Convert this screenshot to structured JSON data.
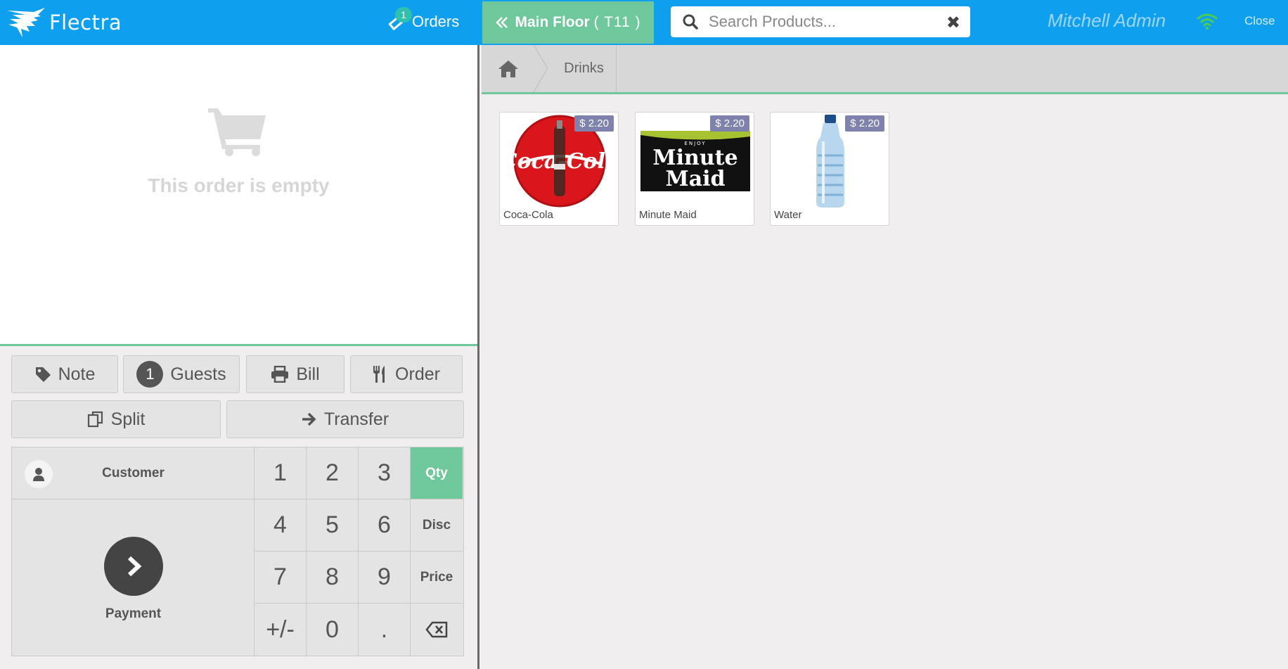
{
  "header": {
    "logo_text": "Flectra",
    "orders_label": "Orders",
    "orders_count": "1",
    "floor_name": "Main Floor",
    "table_label": "( T11 )",
    "search_placeholder": "Search Products...",
    "user_name": "Mitchell Admin",
    "close_label": "Close",
    "brand_color": "#0f9fef",
    "accent_color": "#6ec89b"
  },
  "order": {
    "empty_message": "This order is empty"
  },
  "controls": {
    "note": "Note",
    "guests_count": "1",
    "guests": "Guests",
    "bill": "Bill",
    "order": "Order",
    "split": "Split",
    "transfer": "Transfer"
  },
  "numpad": {
    "customer": "Customer",
    "payment": "Payment",
    "keys": [
      "1",
      "2",
      "3",
      "4",
      "5",
      "6",
      "7",
      "8",
      "9",
      "+/-",
      "0",
      "."
    ],
    "modes": [
      "Qty",
      "Disc",
      "Price"
    ],
    "active_mode": "Qty"
  },
  "breadcrumb": {
    "category": "Drinks"
  },
  "products": [
    {
      "name": "Coca-Cola",
      "price": "$ 2.20"
    },
    {
      "name": "Minute Maid",
      "price": "$ 2.20"
    },
    {
      "name": "Water",
      "price": "$ 2.20"
    }
  ]
}
